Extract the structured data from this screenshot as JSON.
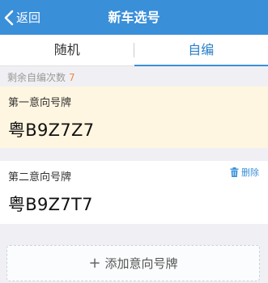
{
  "header": {
    "back_label": "返回",
    "title": "新车选号",
    "background": "#3a8fd9"
  },
  "tabs": [
    {
      "label": "随机",
      "active": false
    },
    {
      "label": "自编",
      "active": true
    }
  ],
  "remaining": {
    "label": "剩余自编次数",
    "count": "7"
  },
  "choices": [
    {
      "label": "第一意向号牌",
      "plate": "粤B9Z7Z7"
    },
    {
      "label": "第二意向号牌",
      "plate": "粤B9Z7T7",
      "delete_label": "删除"
    }
  ],
  "add_button": {
    "plus": "+",
    "label": "添加意向号牌"
  },
  "colors": {
    "accent": "#3a8fd9",
    "highlight": "#fff6e1",
    "count": "#f0883a"
  }
}
